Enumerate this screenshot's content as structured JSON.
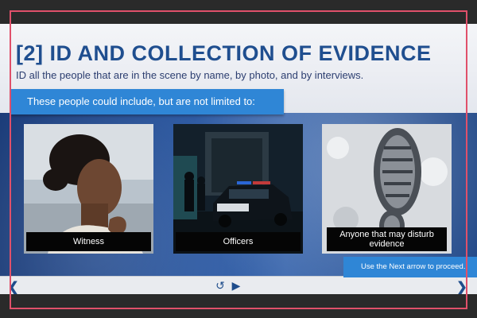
{
  "slide": {
    "title": "[2] ID AND COLLECTION OF EVIDENCE",
    "subtitle": "ID all the people that are in the scene by name, by photo, and by interviews.",
    "callout": "These people could include, but are not limited to:"
  },
  "cards": [
    {
      "caption": "Witness",
      "image": "woman-portrait-photo"
    },
    {
      "caption": "Officers",
      "image": "police-car-night-photo"
    },
    {
      "caption": "Anyone that may disturb evidence",
      "image": "shoeprint-snow-photo"
    }
  ],
  "hint": {
    "text": "Use the Next arrow to proceed."
  },
  "nav": {
    "prev_icon": "chevron-left-icon",
    "next_icon": "chevron-right-icon",
    "replay_icon": "replay-icon",
    "play_icon": "play-icon"
  },
  "colors": {
    "title": "#1f4e8f",
    "accent": "#2f86d6",
    "frame": "#e0506a"
  }
}
